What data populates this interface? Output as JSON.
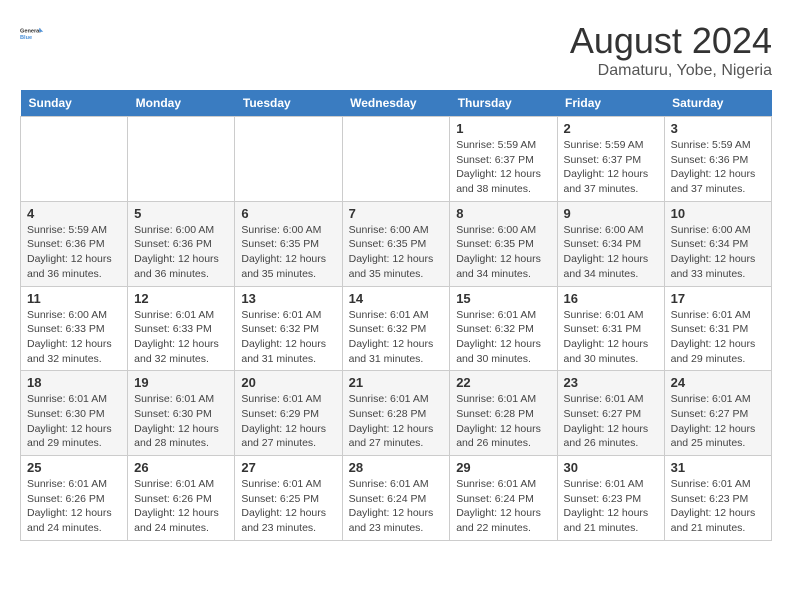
{
  "logo": {
    "line1": "General",
    "line2": "Blue"
  },
  "title": "August 2024",
  "location": "Damaturu, Yobe, Nigeria",
  "days_of_week": [
    "Sunday",
    "Monday",
    "Tuesday",
    "Wednesday",
    "Thursday",
    "Friday",
    "Saturday"
  ],
  "weeks": [
    [
      {
        "day": "",
        "info": ""
      },
      {
        "day": "",
        "info": ""
      },
      {
        "day": "",
        "info": ""
      },
      {
        "day": "",
        "info": ""
      },
      {
        "day": "1",
        "info": "Sunrise: 5:59 AM\nSunset: 6:37 PM\nDaylight: 12 hours\nand 38 minutes."
      },
      {
        "day": "2",
        "info": "Sunrise: 5:59 AM\nSunset: 6:37 PM\nDaylight: 12 hours\nand 37 minutes."
      },
      {
        "day": "3",
        "info": "Sunrise: 5:59 AM\nSunset: 6:36 PM\nDaylight: 12 hours\nand 37 minutes."
      }
    ],
    [
      {
        "day": "4",
        "info": "Sunrise: 5:59 AM\nSunset: 6:36 PM\nDaylight: 12 hours\nand 36 minutes."
      },
      {
        "day": "5",
        "info": "Sunrise: 6:00 AM\nSunset: 6:36 PM\nDaylight: 12 hours\nand 36 minutes."
      },
      {
        "day": "6",
        "info": "Sunrise: 6:00 AM\nSunset: 6:35 PM\nDaylight: 12 hours\nand 35 minutes."
      },
      {
        "day": "7",
        "info": "Sunrise: 6:00 AM\nSunset: 6:35 PM\nDaylight: 12 hours\nand 35 minutes."
      },
      {
        "day": "8",
        "info": "Sunrise: 6:00 AM\nSunset: 6:35 PM\nDaylight: 12 hours\nand 34 minutes."
      },
      {
        "day": "9",
        "info": "Sunrise: 6:00 AM\nSunset: 6:34 PM\nDaylight: 12 hours\nand 34 minutes."
      },
      {
        "day": "10",
        "info": "Sunrise: 6:00 AM\nSunset: 6:34 PM\nDaylight: 12 hours\nand 33 minutes."
      }
    ],
    [
      {
        "day": "11",
        "info": "Sunrise: 6:00 AM\nSunset: 6:33 PM\nDaylight: 12 hours\nand 32 minutes."
      },
      {
        "day": "12",
        "info": "Sunrise: 6:01 AM\nSunset: 6:33 PM\nDaylight: 12 hours\nand 32 minutes."
      },
      {
        "day": "13",
        "info": "Sunrise: 6:01 AM\nSunset: 6:32 PM\nDaylight: 12 hours\nand 31 minutes."
      },
      {
        "day": "14",
        "info": "Sunrise: 6:01 AM\nSunset: 6:32 PM\nDaylight: 12 hours\nand 31 minutes."
      },
      {
        "day": "15",
        "info": "Sunrise: 6:01 AM\nSunset: 6:32 PM\nDaylight: 12 hours\nand 30 minutes."
      },
      {
        "day": "16",
        "info": "Sunrise: 6:01 AM\nSunset: 6:31 PM\nDaylight: 12 hours\nand 30 minutes."
      },
      {
        "day": "17",
        "info": "Sunrise: 6:01 AM\nSunset: 6:31 PM\nDaylight: 12 hours\nand 29 minutes."
      }
    ],
    [
      {
        "day": "18",
        "info": "Sunrise: 6:01 AM\nSunset: 6:30 PM\nDaylight: 12 hours\nand 29 minutes."
      },
      {
        "day": "19",
        "info": "Sunrise: 6:01 AM\nSunset: 6:30 PM\nDaylight: 12 hours\nand 28 minutes."
      },
      {
        "day": "20",
        "info": "Sunrise: 6:01 AM\nSunset: 6:29 PM\nDaylight: 12 hours\nand 27 minutes."
      },
      {
        "day": "21",
        "info": "Sunrise: 6:01 AM\nSunset: 6:28 PM\nDaylight: 12 hours\nand 27 minutes."
      },
      {
        "day": "22",
        "info": "Sunrise: 6:01 AM\nSunset: 6:28 PM\nDaylight: 12 hours\nand 26 minutes."
      },
      {
        "day": "23",
        "info": "Sunrise: 6:01 AM\nSunset: 6:27 PM\nDaylight: 12 hours\nand 26 minutes."
      },
      {
        "day": "24",
        "info": "Sunrise: 6:01 AM\nSunset: 6:27 PM\nDaylight: 12 hours\nand 25 minutes."
      }
    ],
    [
      {
        "day": "25",
        "info": "Sunrise: 6:01 AM\nSunset: 6:26 PM\nDaylight: 12 hours\nand 24 minutes."
      },
      {
        "day": "26",
        "info": "Sunrise: 6:01 AM\nSunset: 6:26 PM\nDaylight: 12 hours\nand 24 minutes."
      },
      {
        "day": "27",
        "info": "Sunrise: 6:01 AM\nSunset: 6:25 PM\nDaylight: 12 hours\nand 23 minutes."
      },
      {
        "day": "28",
        "info": "Sunrise: 6:01 AM\nSunset: 6:24 PM\nDaylight: 12 hours\nand 23 minutes."
      },
      {
        "day": "29",
        "info": "Sunrise: 6:01 AM\nSunset: 6:24 PM\nDaylight: 12 hours\nand 22 minutes."
      },
      {
        "day": "30",
        "info": "Sunrise: 6:01 AM\nSunset: 6:23 PM\nDaylight: 12 hours\nand 21 minutes."
      },
      {
        "day": "31",
        "info": "Sunrise: 6:01 AM\nSunset: 6:23 PM\nDaylight: 12 hours\nand 21 minutes."
      }
    ]
  ]
}
